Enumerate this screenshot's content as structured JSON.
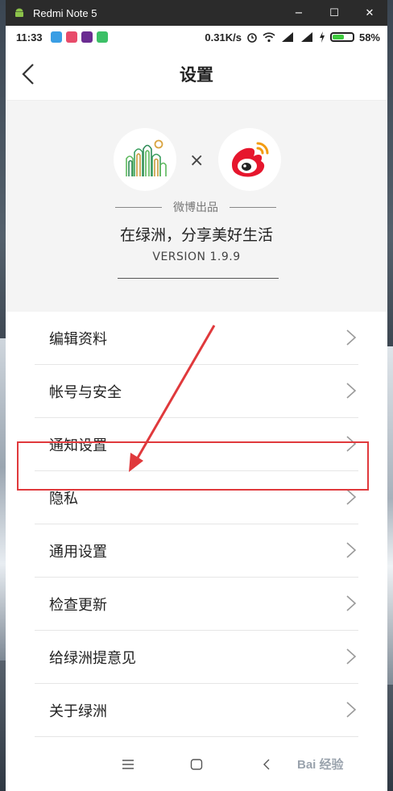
{
  "window": {
    "title": "Redmi Note 5",
    "minimize": "−",
    "maximize": "☐",
    "close": "✕"
  },
  "status_bar": {
    "time": "11:33",
    "net_speed": "0.31K/s",
    "battery": "58%",
    "battery_level": 0.58,
    "battery_color": "#3ecb3e"
  },
  "header": {
    "title": "设置"
  },
  "banner": {
    "cross": "×",
    "made_by": "微博出品",
    "slogan": "在绿洲，分享美好生活",
    "version": "VERSION 1.9.9"
  },
  "menu": {
    "items": [
      {
        "label": "编辑资料"
      },
      {
        "label": "帐号与安全"
      },
      {
        "label": "通知设置"
      },
      {
        "label": "隐私"
      },
      {
        "label": "通用设置"
      },
      {
        "label": "检查更新"
      },
      {
        "label": "给绿洲提意见"
      },
      {
        "label": "关于绿洲"
      }
    ]
  },
  "annotation": {
    "highlight_color": "#e0393c"
  },
  "watermark": {
    "text": "Bai 经验"
  }
}
